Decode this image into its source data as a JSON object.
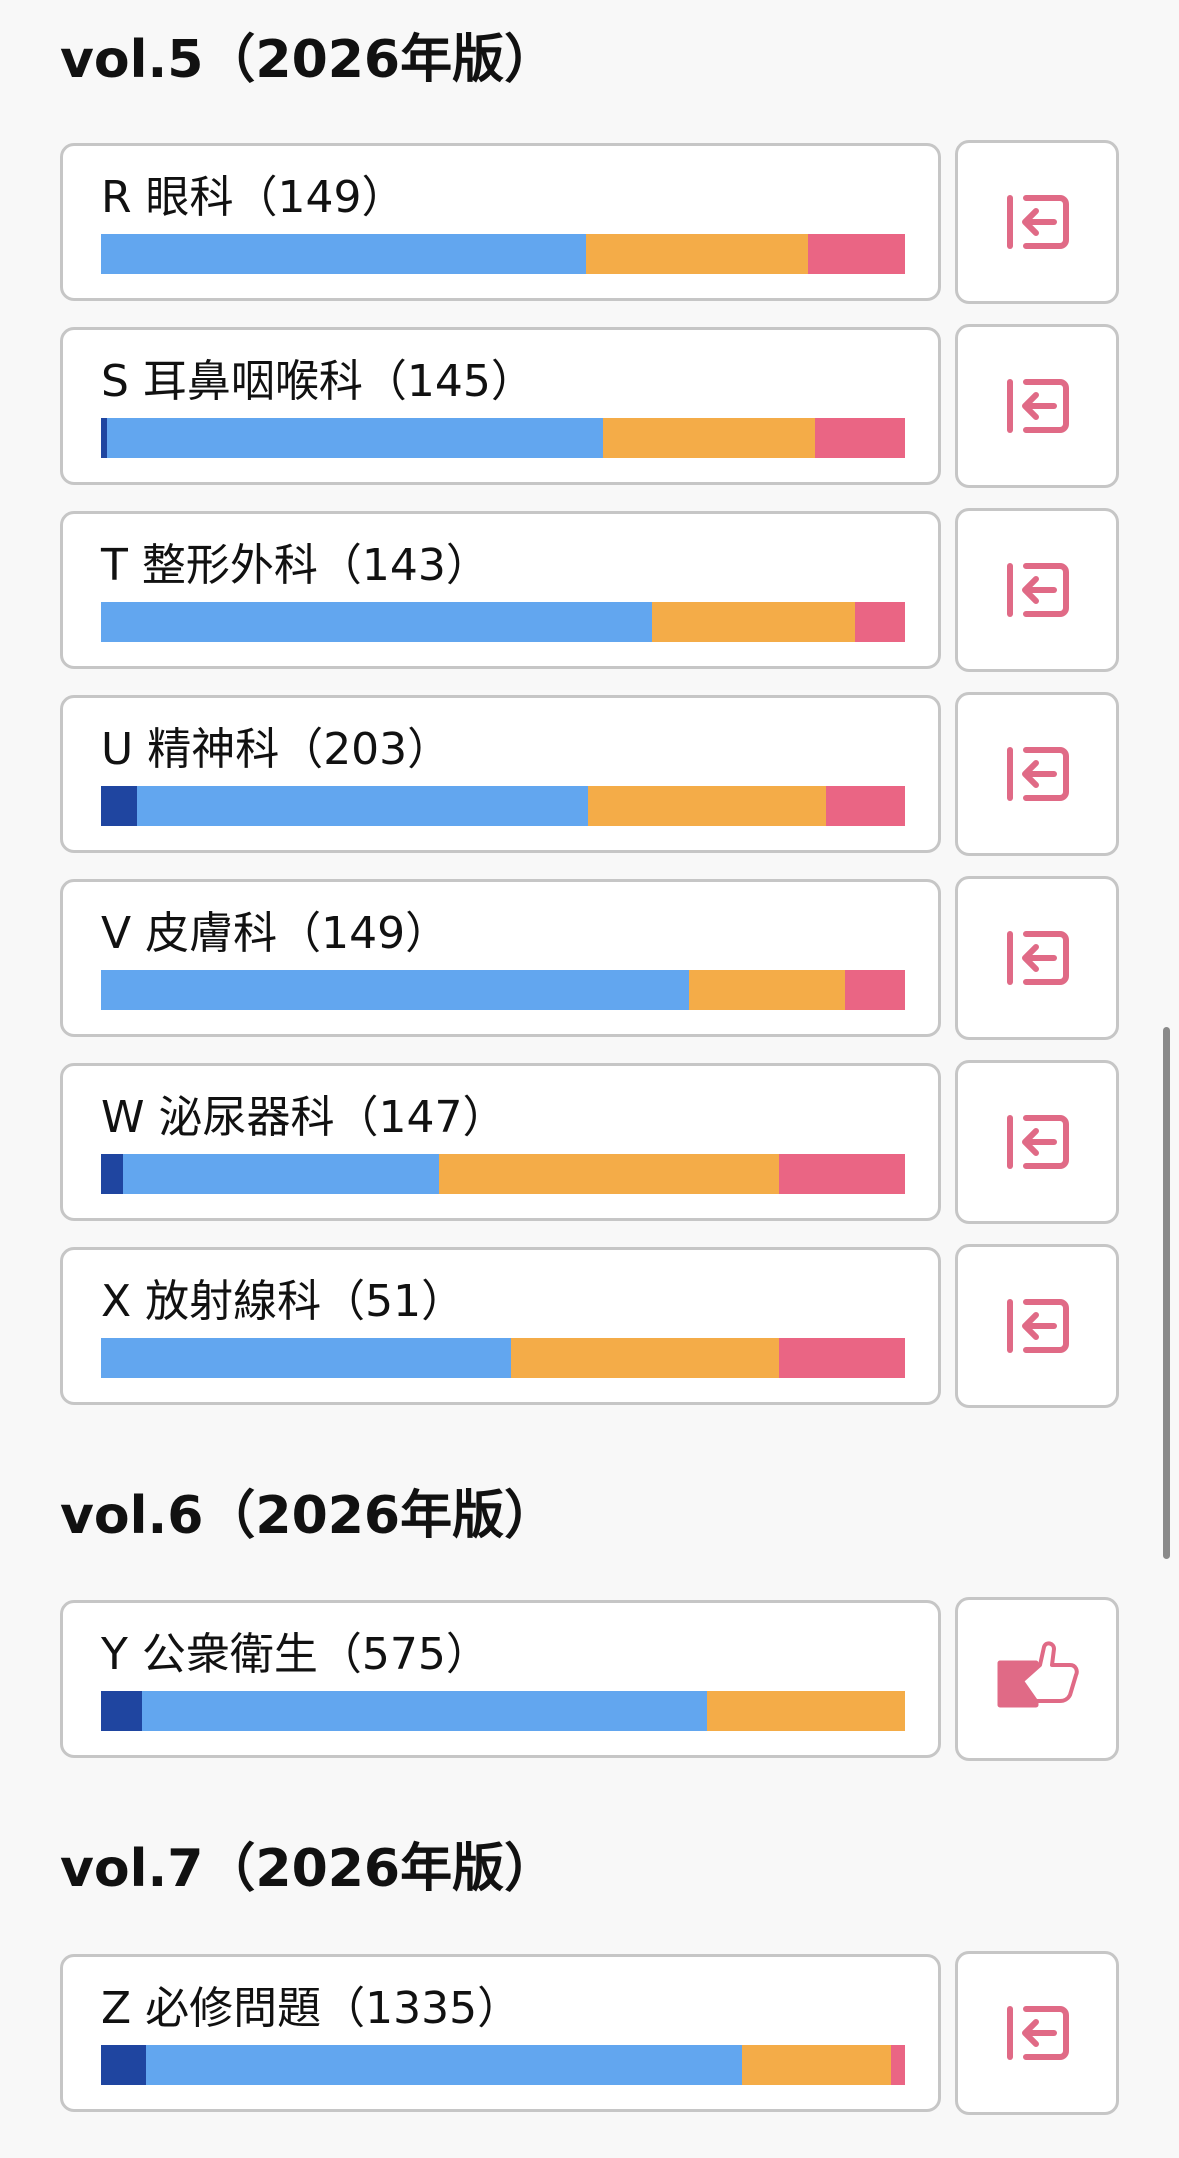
{
  "colors": {
    "dark_blue": "#1f45a0",
    "blue": "#62a6ef",
    "orange": "#f4ac48",
    "pink": "#ea6584",
    "icon": "#e06a86"
  },
  "sections": [
    {
      "title": "vol.5（2026年版）",
      "items": [
        {
          "label": "R 眼科（149）",
          "icon": "enter-arrow-icon",
          "progress": [
            0,
            60.3,
            27.6,
            12.1
          ]
        },
        {
          "label": "S 耳鼻咽喉科（145）",
          "icon": "enter-arrow-icon",
          "progress": [
            0.7,
            61.8,
            26.3,
            11.2
          ]
        },
        {
          "label": "T 整形外科（143）",
          "icon": "enter-arrow-icon",
          "progress": [
            0,
            68.5,
            25.3,
            6.2
          ]
        },
        {
          "label": "U 精神科（203）",
          "icon": "enter-arrow-icon",
          "progress": [
            4.5,
            56.1,
            29.6,
            9.8
          ]
        },
        {
          "label": "V 皮膚科（149）",
          "icon": "enter-arrow-icon",
          "progress": [
            0,
            73.1,
            19.5,
            7.4
          ]
        },
        {
          "label": "W 泌尿器科（147）",
          "icon": "enter-arrow-icon",
          "progress": [
            2.7,
            39.4,
            42.2,
            15.7
          ]
        },
        {
          "label": "X 放射線科（51）",
          "icon": "enter-arrow-icon",
          "progress": [
            0,
            51.0,
            33.3,
            15.7
          ]
        }
      ]
    },
    {
      "title": "vol.6（2026年版）",
      "items": [
        {
          "label": "Y 公衆衛生（575）",
          "icon": "thumbs-up-icon",
          "progress": [
            5.1,
            70.3,
            24.6,
            0
          ]
        }
      ]
    },
    {
      "title": "vol.7（2026年版）",
      "items": [
        {
          "label": "Z 必修問題（1335）",
          "icon": "enter-arrow-icon",
          "progress": [
            5.6,
            74.1,
            18.6,
            1.7
          ]
        }
      ]
    }
  ]
}
